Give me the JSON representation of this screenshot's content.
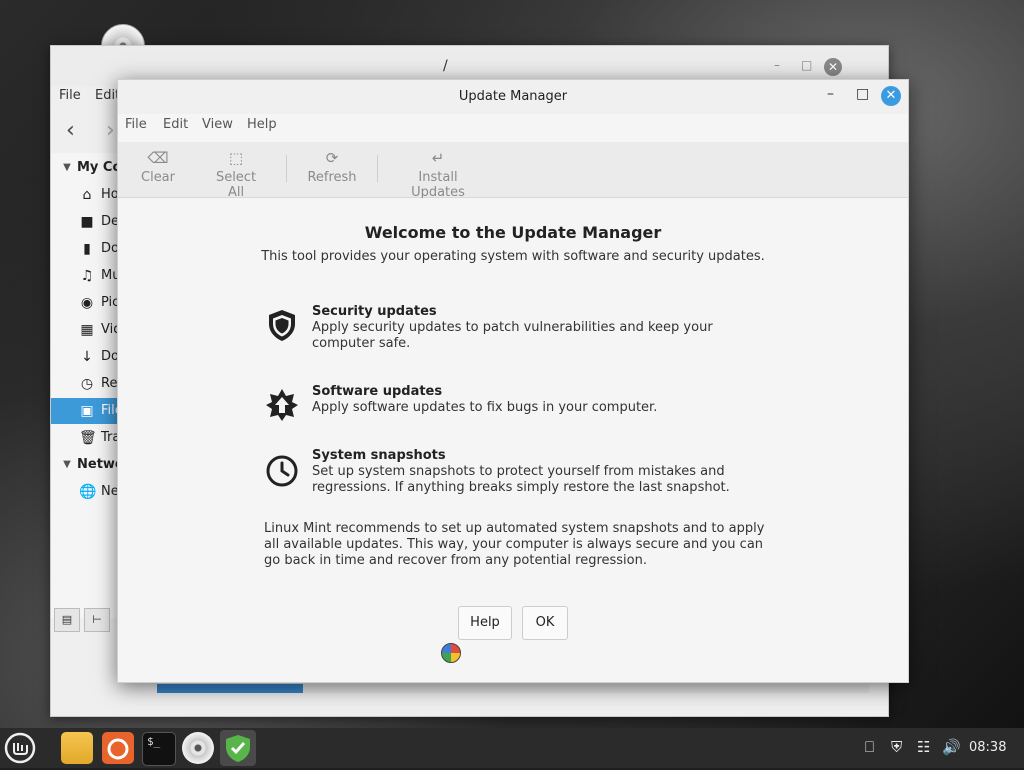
{
  "back_window": {
    "title": "/",
    "menu": [
      "File",
      "Edit"
    ],
    "sidebar": [
      {
        "label": "My Computer",
        "icon": "triangle-down-icon",
        "header": true
      },
      {
        "label": "Home",
        "icon": "home-icon"
      },
      {
        "label": "Desktop",
        "icon": "desktop-icon"
      },
      {
        "label": "Documents",
        "icon": "document-icon"
      },
      {
        "label": "Music",
        "icon": "music-icon"
      },
      {
        "label": "Pictures",
        "icon": "camera-icon"
      },
      {
        "label": "Videos",
        "icon": "film-icon"
      },
      {
        "label": "Downloads",
        "icon": "download-icon"
      },
      {
        "label": "Recent",
        "icon": "clock-icon"
      },
      {
        "label": "File System",
        "icon": "drive-icon",
        "selected": true
      },
      {
        "label": "Trash",
        "icon": "trash-icon"
      },
      {
        "label": "Network",
        "icon": "triangle-down-icon",
        "header": true
      },
      {
        "label": "Network",
        "icon": "globe-icon"
      }
    ],
    "progress_fraction": 0.205
  },
  "update_manager": {
    "title": "Update Manager",
    "menu": {
      "file": "File",
      "edit": "Edit",
      "view": "View",
      "help": "Help"
    },
    "toolbar": {
      "clear": "Clear",
      "select_all": "Select All",
      "refresh": "Refresh",
      "install": "Install Updates"
    },
    "welcome": {
      "title": "Welcome to the Update Manager",
      "subtitle": "This tool provides your operating system with software and security updates."
    },
    "features": [
      {
        "icon": "shield-icon",
        "title": "Security updates",
        "desc": "Apply security updates to patch vulnerabilities and keep your computer safe."
      },
      {
        "icon": "upgrade-star-icon",
        "title": "Software updates",
        "desc": "Apply software updates to fix bugs in your computer."
      },
      {
        "icon": "clock-icon",
        "title": "System snapshots",
        "desc": "Set up system snapshots to protect yourself from mistakes and regressions. If anything breaks simply restore the last snapshot."
      }
    ],
    "recommendation": "Linux Mint recommends to set up automated system snapshots and to apply all available updates. This way, your computer is always secure and you can go back in time and recover from any potential regression.",
    "buttons": {
      "help": "Help",
      "ok": "OK"
    }
  },
  "taskbar": {
    "apps": [
      "mint-menu-icon",
      "files-icon",
      "firefox-icon",
      "terminal-icon",
      "disc-icon",
      "update-manager-icon"
    ],
    "clock": "08:38"
  },
  "colors": {
    "accent": "#3b9be0",
    "progress": "#3584c8",
    "taskbar": "#2b2b2b"
  }
}
